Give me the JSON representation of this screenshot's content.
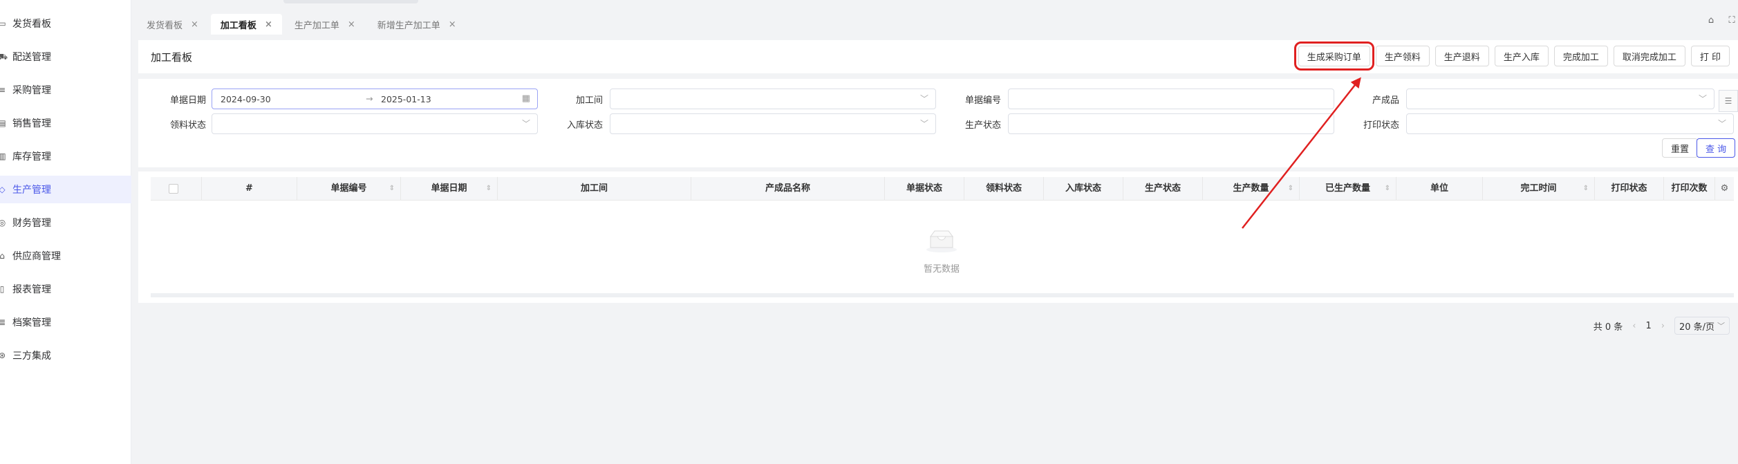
{
  "sidebar": {
    "items": [
      {
        "label": "发货看板",
        "icon": "monitor-icon"
      },
      {
        "label": "配送管理",
        "icon": "truck-icon"
      },
      {
        "label": "采购管理",
        "icon": "cart-icon"
      },
      {
        "label": "销售管理",
        "icon": "sales-icon"
      },
      {
        "label": "库存管理",
        "icon": "warehouse-icon"
      },
      {
        "label": "生产管理",
        "icon": "production-icon"
      },
      {
        "label": "财务管理",
        "icon": "finance-icon"
      },
      {
        "label": "供应商管理",
        "icon": "supplier-icon"
      },
      {
        "label": "报表管理",
        "icon": "report-icon"
      },
      {
        "label": "档案管理",
        "icon": "archive-icon"
      },
      {
        "label": "三方集成",
        "icon": "integration-icon"
      }
    ],
    "active_index": 5
  },
  "tabs": [
    {
      "label": "发货看板",
      "active": false
    },
    {
      "label": "加工看板",
      "active": true
    },
    {
      "label": "生产加工单",
      "active": false
    },
    {
      "label": "新增生产加工单",
      "active": false
    }
  ],
  "tab_close_glyph": "×",
  "header": {
    "title": "加工看板",
    "buttons": [
      {
        "label": "生成采购订单",
        "highlighted": true
      },
      {
        "label": "生产领料"
      },
      {
        "label": "生产退料"
      },
      {
        "label": "生产入库"
      },
      {
        "label": "完成加工"
      },
      {
        "label": "取消完成加工"
      },
      {
        "label": "打 印"
      }
    ]
  },
  "filters": {
    "doc_date_label": "单据日期",
    "date_start": "2024-09-30",
    "date_sep": "→",
    "date_end": "2025-01-13",
    "workshop_label": "加工间",
    "doc_no_label": "单据编号",
    "product_label": "产成品",
    "pick_status_label": "领料状态",
    "stock_in_status_label": "入库状态",
    "prod_status_label": "生产状态",
    "print_status_label": "打印状态",
    "reset_label": "重置",
    "query_label": "查 询"
  },
  "table": {
    "columns": [
      "#",
      "单据编号",
      "单据日期",
      "加工间",
      "产成品名称",
      "单据状态",
      "领料状态",
      "入库状态",
      "生产状态",
      "生产数量",
      "已生产数量",
      "单位",
      "完工时间",
      "打印状态",
      "打印次数"
    ],
    "empty_text": "暂无数据"
  },
  "pagination": {
    "total_text": "共 0 条",
    "current_page": "1",
    "page_size": "20 条/页"
  },
  "colors": {
    "accent": "#4a57e8",
    "highlight_box": "#e02020"
  }
}
